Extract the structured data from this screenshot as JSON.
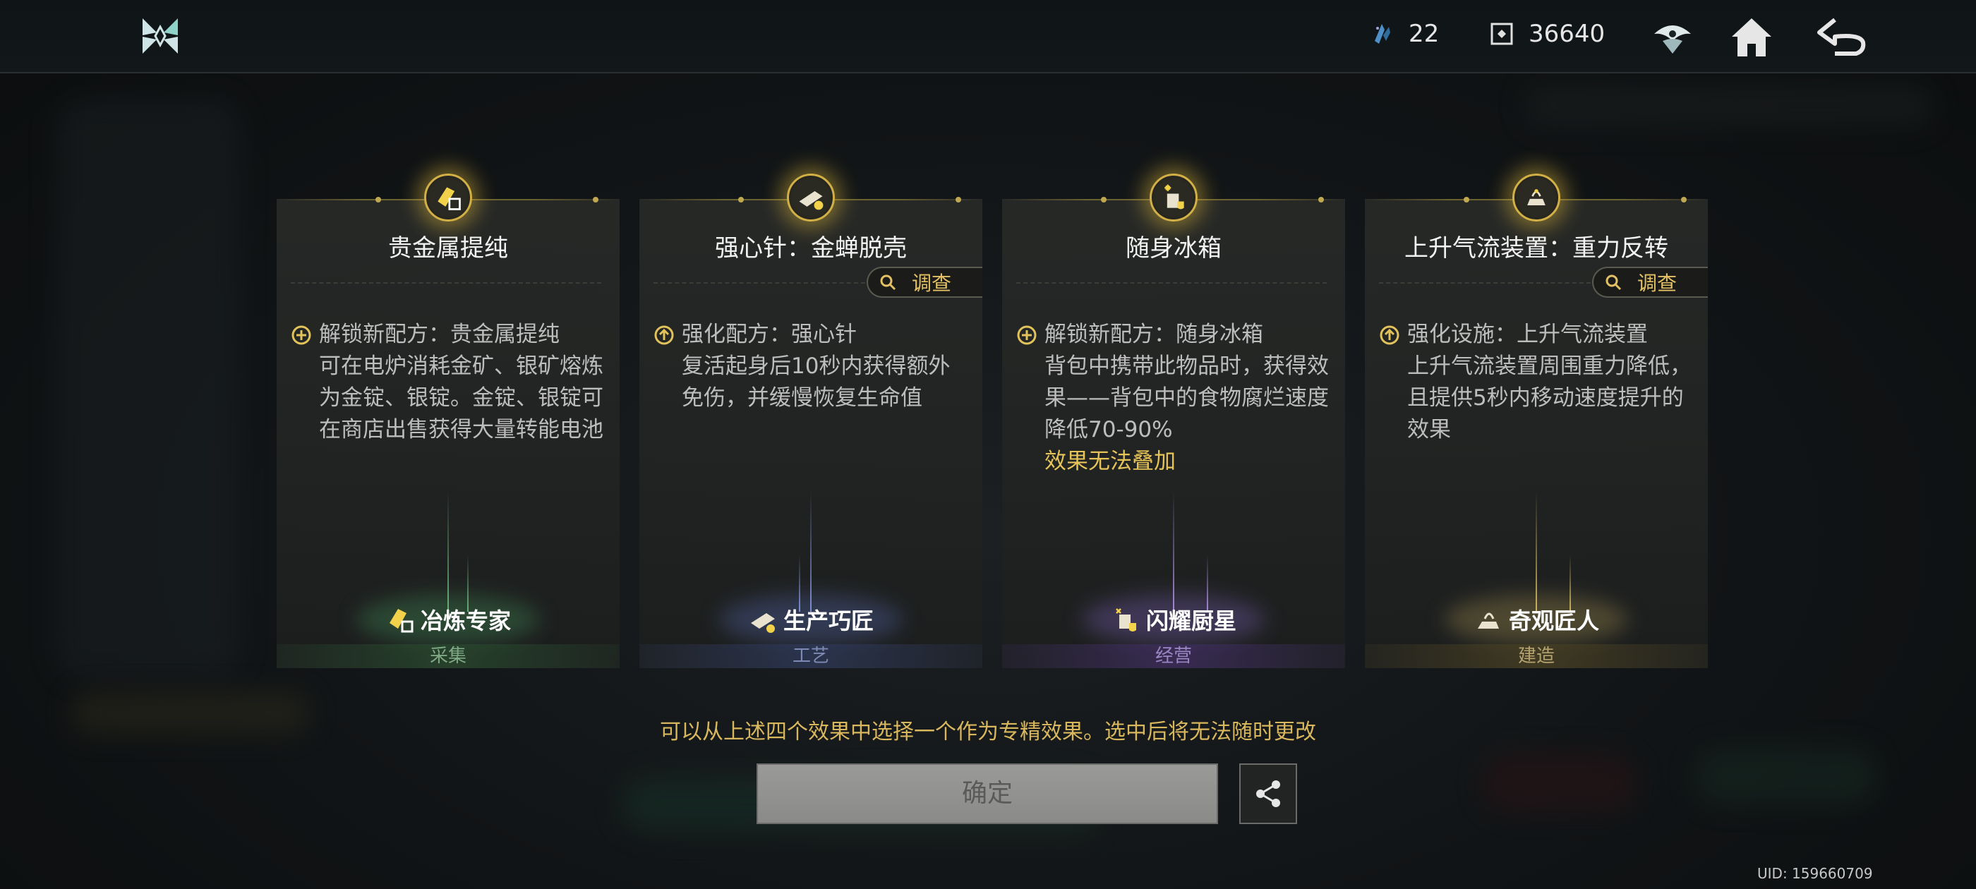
{
  "topbar": {
    "resources": [
      {
        "icon": "crystal-icon",
        "value": "22"
      },
      {
        "icon": "module-icon",
        "value": "36640"
      }
    ],
    "icons": [
      "shield-emblem-icon",
      "home-icon",
      "back-icon"
    ]
  },
  "cards": [
    {
      "title": "贵金属提纯",
      "icon": "gold-bar-icon",
      "has_investigate": false,
      "desc_lines": [
        "解锁新配方：贵金属提纯",
        "可在电炉消耗金矿、银矿熔炼为金锭、银锭。金锭、银锭可在商店出售获得大量转能电池"
      ],
      "warning": "",
      "badge": "冶炼专家",
      "category": "采集",
      "accent": "#6ba06f"
    },
    {
      "title": "强心针：金蝉脱壳",
      "icon": "syringe-icon",
      "has_investigate": true,
      "desc_lines": [
        "强化配方：强心针",
        "复活起身后10秒内获得额外免伤，并缓慢恢复生命值"
      ],
      "warning": "",
      "badge": "生产巧匠",
      "category": "工艺",
      "accent": "#6d7fb8"
    },
    {
      "title": "随身冰箱",
      "icon": "fridge-icon",
      "has_investigate": false,
      "desc_lines": [
        "解锁新配方：随身冰箱",
        "背包中携带此物品时，获得效果——背包中的食物腐烂速度降低70-90%"
      ],
      "warning": "效果无法叠加",
      "badge": "闪耀厨星",
      "category": "经营",
      "accent": "#9278c4"
    },
    {
      "title": "上升气流装置：重力反转",
      "icon": "updraft-device-icon",
      "has_investigate": true,
      "desc_lines": [
        "强化设施：上升气流装置",
        "上升气流装置周围重力降低，且提供5秒内移动速度提升的效果"
      ],
      "warning": "",
      "badge": "奇观匠人",
      "category": "建造",
      "accent": "#b8a460"
    }
  ],
  "investigate_label": "调查",
  "hint": "可以从上述四个效果中选择一个作为专精效果。选中后将无法随时更改",
  "confirm_label": "确定",
  "uid": "UID: 159660709"
}
